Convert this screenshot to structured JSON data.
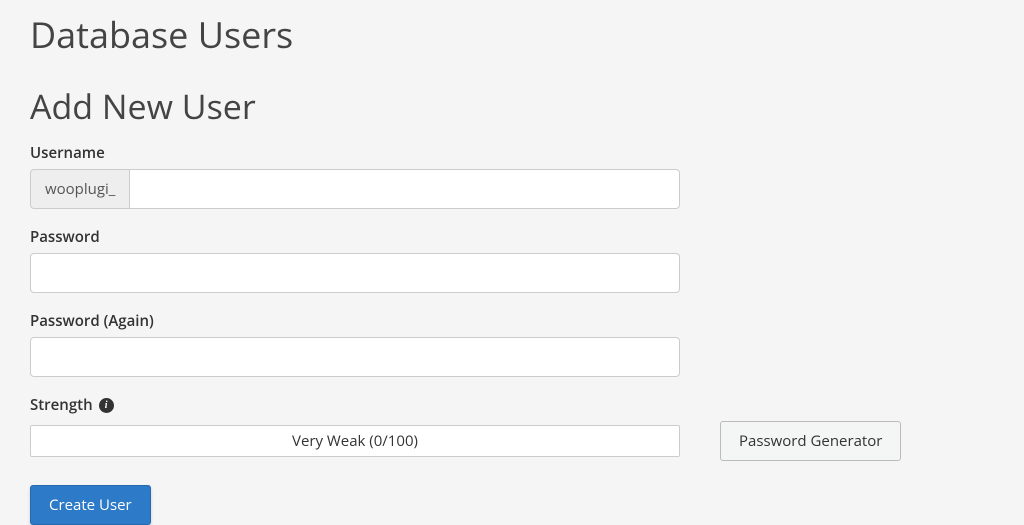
{
  "page_title": "Database Users",
  "section_title": "Add New User",
  "form": {
    "username": {
      "label": "Username",
      "prefix": "wooplugi_",
      "value": ""
    },
    "password": {
      "label": "Password",
      "value": ""
    },
    "password_again": {
      "label": "Password (Again)",
      "value": ""
    },
    "strength": {
      "label": "Strength",
      "status": "Very Weak (0/100)"
    }
  },
  "buttons": {
    "password_generator": "Password Generator",
    "create_user": "Create User"
  }
}
